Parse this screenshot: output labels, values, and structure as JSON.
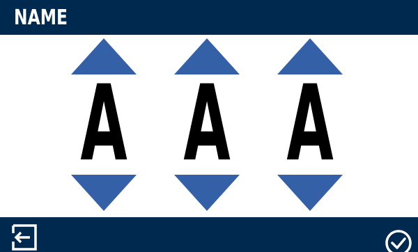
{
  "header": {
    "title": "NAME"
  },
  "characters": [
    {
      "value": "A"
    },
    {
      "value": "A"
    },
    {
      "value": "A"
    }
  ],
  "icons": {
    "up": "up-arrow-icon",
    "down": "down-arrow-icon",
    "exit": "exit-icon",
    "confirm": "checkmark-icon"
  },
  "colors": {
    "header_bg": "#00294f",
    "arrow": "#3460a8",
    "text": "#000000",
    "background": "#ffffff"
  }
}
